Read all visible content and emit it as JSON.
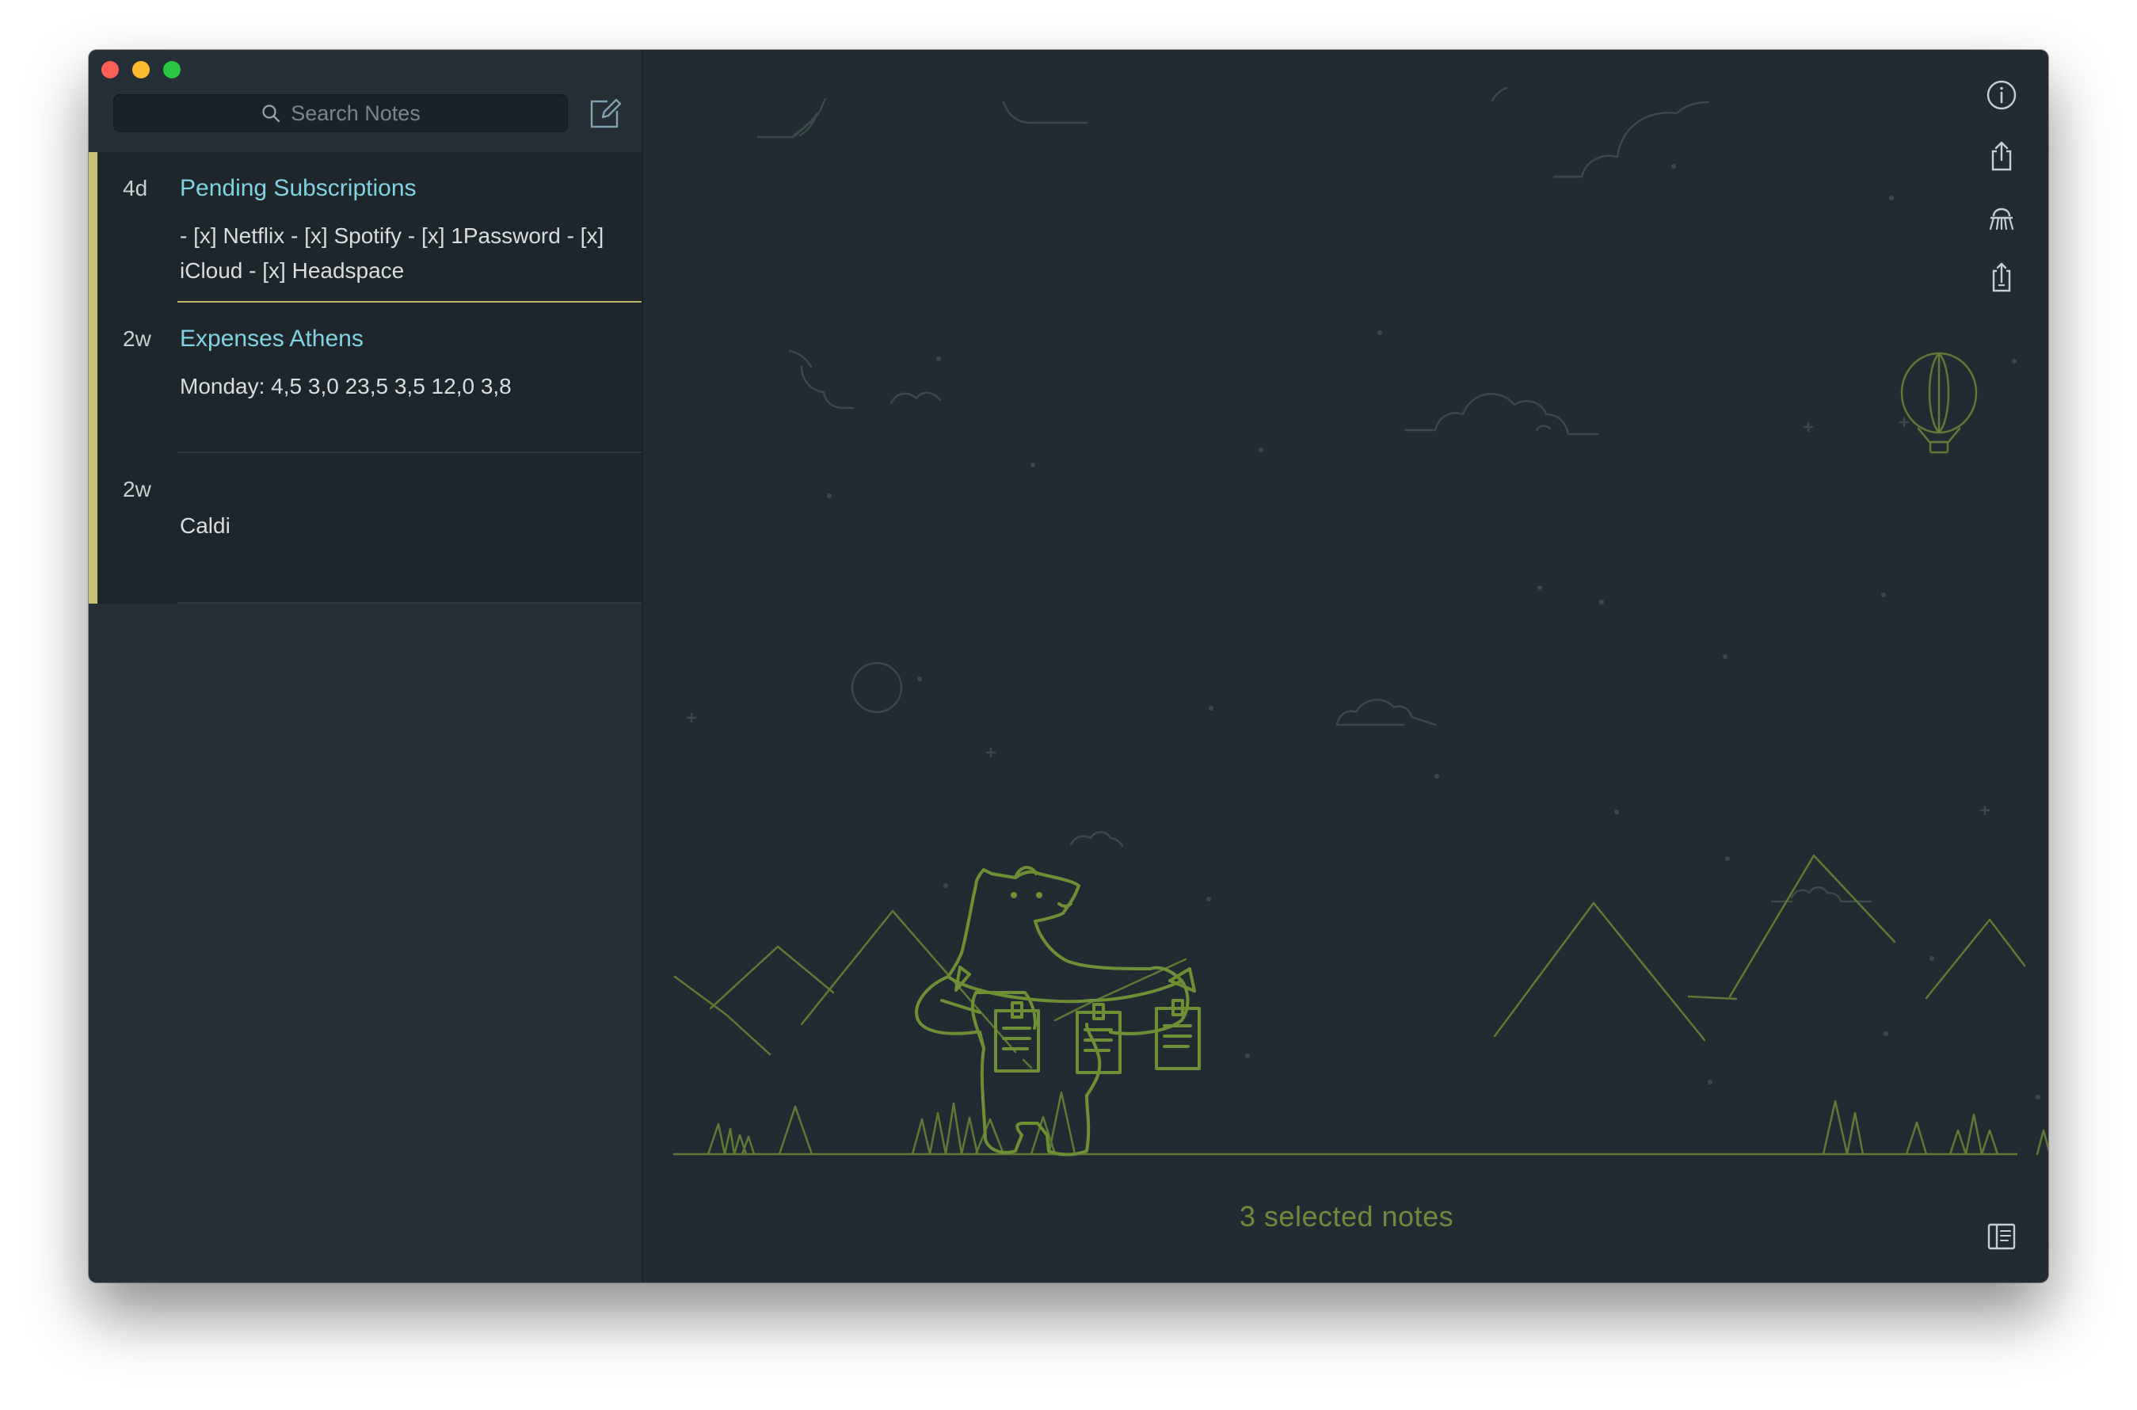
{
  "window": {
    "controls": [
      "close",
      "minimize",
      "zoom"
    ]
  },
  "sidebar": {
    "search": {
      "placeholder": "Search Notes",
      "icon": "search-icon"
    },
    "compose_icon": "compose-icon",
    "notes": [
      {
        "age": "4d",
        "title": "Pending Subscriptions",
        "preview": "- [x] Netflix - [x] Spotify - [x] 1Password - [x] iCloud - [x] Headspace",
        "selected": true
      },
      {
        "age": "2w",
        "title": "Expenses Athens",
        "preview": "Monday: 4,5 3,0 23,5 3,5 12,0 3,8",
        "selected": true
      },
      {
        "age": "2w",
        "title": "",
        "preview": "Caldi",
        "selected": true
      }
    ]
  },
  "main": {
    "selection_label": "3 selected notes",
    "toolbar_icons": [
      "info-icon",
      "share-icon",
      "archive-icon",
      "export-icon"
    ],
    "bottom_icon": "toggle-sidebar-icon"
  },
  "colors": {
    "window_bg": "#222b32",
    "sidebar_bg": "#262f35",
    "note_title": "#7fd3e2",
    "selection_bar": "#c9c07a",
    "illustration": "#5f7a35",
    "sky_lines": "#3a4a48"
  }
}
